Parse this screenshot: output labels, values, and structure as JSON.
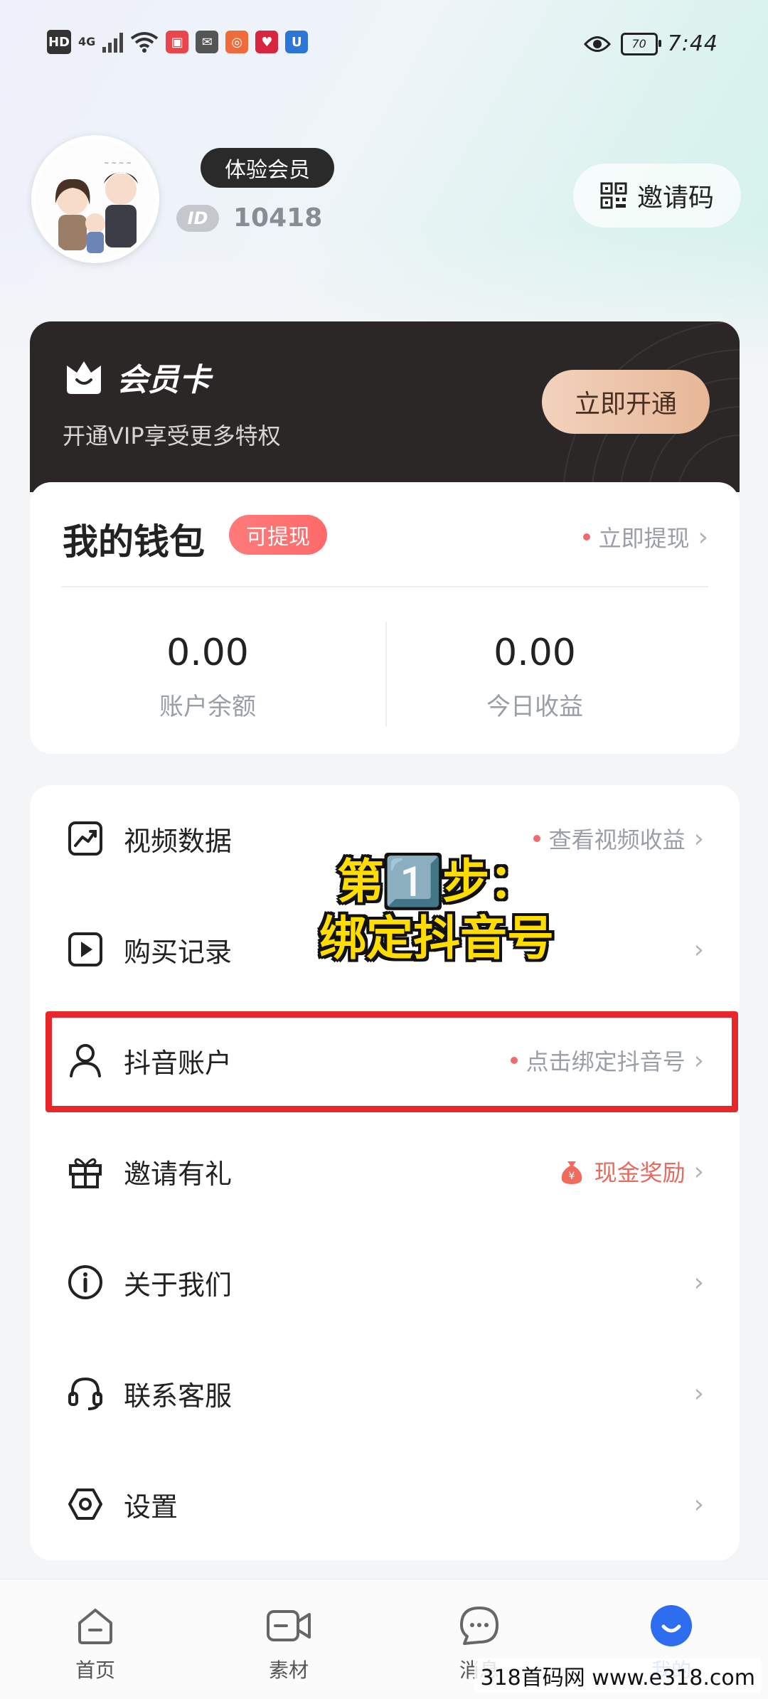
{
  "status_bar": {
    "hd": "HD",
    "net": "4G",
    "battery": "70",
    "time": "7:44"
  },
  "profile": {
    "member_badge": "体验会员",
    "id_tag": "ID",
    "id_number": "10418",
    "invite_code_label": "邀请码"
  },
  "vip_card": {
    "title": "会员卡",
    "subtitle": "开通VIP享受更多特权",
    "button": "立即开通"
  },
  "wallet": {
    "title": "我的钱包",
    "badge": "可提现",
    "link": "立即提现",
    "balance_value": "0.00",
    "balance_label": "账户余额",
    "today_value": "0.00",
    "today_label": "今日收益"
  },
  "menu": [
    {
      "label": "视频数据",
      "right": "查看视频收益",
      "icon": "chart-icon"
    },
    {
      "label": "购买记录",
      "right": "",
      "icon": "play-icon"
    },
    {
      "label": "抖音账户",
      "right": "点击绑定抖音号",
      "icon": "user-icon"
    },
    {
      "label": "邀请有礼",
      "right": "现金奖励",
      "icon": "gift-icon"
    },
    {
      "label": "关于我们",
      "right": "",
      "icon": "info-icon"
    },
    {
      "label": "联系客服",
      "right": "",
      "icon": "headset-icon"
    },
    {
      "label": "设置",
      "right": "",
      "icon": "settings-icon"
    }
  ],
  "overlay": {
    "line1": "第1️⃣步：",
    "line2": "绑定抖音号"
  },
  "nav": [
    {
      "label": "首页",
      "icon": "home-icon"
    },
    {
      "label": "素材",
      "icon": "video-icon"
    },
    {
      "label": "消息",
      "icon": "message-icon"
    },
    {
      "label": "我的",
      "icon": "profile-icon"
    }
  ],
  "colors": {
    "accent": "#2f6df0",
    "highlight_box": "#e8272b",
    "overlay_text": "#ffdd00"
  },
  "watermark": "318首码网 www.e318.com"
}
